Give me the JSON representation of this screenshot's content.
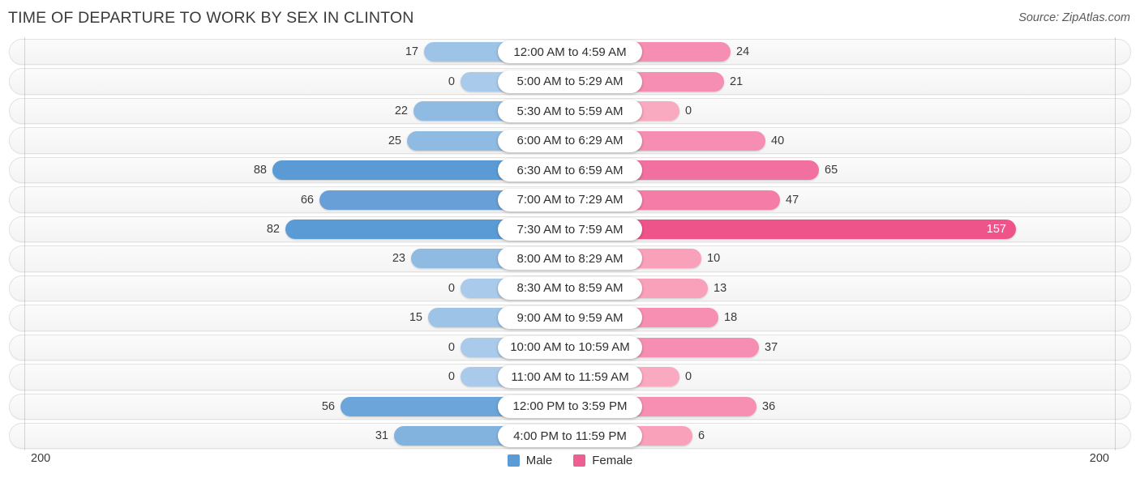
{
  "header": {
    "title": "TIME OF DEPARTURE TO WORK BY SEX IN CLINTON",
    "source": "Source: ZipAtlas.com"
  },
  "axis": {
    "left_label": "200",
    "right_label": "200"
  },
  "legend": {
    "items": [
      {
        "label": "Male",
        "color": "#5B9BD5",
        "icon": "square-swatch"
      },
      {
        "label": "Female",
        "color": "#ED5E93",
        "icon": "square-swatch"
      }
    ]
  },
  "colors": {
    "male_strong": "#5B9BD5",
    "male_light": "#9DC3E6",
    "female_strong": "#EE5389",
    "female_mid": "#F47CA6",
    "female_light": "#F9A9C0",
    "track": "#F6F6F6",
    "text": "#3A3A3A"
  },
  "chart_data": {
    "type": "bar",
    "orientation": "horizontal",
    "style": "diverging-bidirectional",
    "title": "TIME OF DEPARTURE TO WORK BY SEX IN CLINTON",
    "xlabel": "",
    "ylabel": "",
    "axis_max": 200,
    "xlim": [
      200,
      200
    ],
    "grid": false,
    "legend_position": "bottom-center",
    "categories": [
      "12:00 AM to 4:59 AM",
      "5:00 AM to 5:29 AM",
      "5:30 AM to 5:59 AM",
      "6:00 AM to 6:29 AM",
      "6:30 AM to 6:59 AM",
      "7:00 AM to 7:29 AM",
      "7:30 AM to 7:59 AM",
      "8:00 AM to 8:29 AM",
      "8:30 AM to 8:59 AM",
      "9:00 AM to 9:59 AM",
      "10:00 AM to 10:59 AM",
      "11:00 AM to 11:59 AM",
      "12:00 PM to 3:59 PM",
      "4:00 PM to 11:59 PM"
    ],
    "series": [
      {
        "name": "Male",
        "values": [
          17,
          0,
          22,
          25,
          88,
          66,
          82,
          23,
          0,
          15,
          0,
          0,
          56,
          31
        ]
      },
      {
        "name": "Female",
        "values": [
          24,
          21,
          0,
          40,
          65,
          47,
          157,
          10,
          13,
          18,
          37,
          0,
          36,
          6
        ]
      }
    ]
  },
  "rows": [
    {
      "label": "12:00 AM to 4:59 AM",
      "male": "17",
      "female": "24",
      "male_w": 107,
      "female_w": 125,
      "male_color": "#9DC3E6",
      "female_color": "#F58EB2",
      "female_inside": false
    },
    {
      "label": "5:00 AM to 5:29 AM",
      "male": "0",
      "female": "21",
      "male_w": 62,
      "female_w": 117,
      "male_color": "#A9CAEA",
      "female_color": "#F58EB2",
      "female_inside": false
    },
    {
      "label": "5:30 AM to 5:59 AM",
      "male": "22",
      "female": "0",
      "male_w": 120,
      "female_w": 62,
      "male_color": "#8FBAE2",
      "female_color": "#F9A9C0",
      "female_inside": false
    },
    {
      "label": "6:00 AM to 6:29 AM",
      "male": "25",
      "female": "40",
      "male_w": 128,
      "female_w": 168,
      "male_color": "#8FBAE2",
      "female_color": "#F58EB2",
      "female_inside": false
    },
    {
      "label": "6:30 AM to 6:59 AM",
      "male": "88",
      "female": "65",
      "male_w": 294,
      "female_w": 234,
      "male_color": "#5B9BD5",
      "female_color": "#F2709F",
      "female_inside": false
    },
    {
      "label": "7:00 AM to 7:29 AM",
      "male": "66",
      "female": "47",
      "male_w": 236,
      "female_w": 186,
      "male_color": "#689FD6",
      "female_color": "#F47CA6",
      "female_inside": false
    },
    {
      "label": "7:30 AM to 7:59 AM",
      "male": "82",
      "female": "157",
      "male_w": 278,
      "female_w": 477,
      "male_color": "#5B9BD5",
      "female_color": "#EE5389",
      "female_inside": true
    },
    {
      "label": "8:00 AM to 8:29 AM",
      "male": "23",
      "female": "10",
      "male_w": 123,
      "female_w": 89,
      "male_color": "#8FBAE2",
      "female_color": "#F9A0BA",
      "female_inside": false
    },
    {
      "label": "8:30 AM to 8:59 AM",
      "male": "0",
      "female": "13",
      "male_w": 62,
      "female_w": 97,
      "male_color": "#A9CAEA",
      "female_color": "#F9A0BA",
      "female_inside": false
    },
    {
      "label": "9:00 AM to 9:59 AM",
      "male": "15",
      "female": "18",
      "male_w": 102,
      "female_w": 110,
      "male_color": "#9DC3E6",
      "female_color": "#F78FB2",
      "female_inside": false
    },
    {
      "label": "10:00 AM to 10:59 AM",
      "male": "0",
      "female": "37",
      "male_w": 62,
      "female_w": 160,
      "male_color": "#A9CAEA",
      "female_color": "#F58EB2",
      "female_inside": false
    },
    {
      "label": "11:00 AM to 11:59 AM",
      "male": "0",
      "female": "0",
      "male_w": 62,
      "female_w": 62,
      "male_color": "#A9CAEA",
      "female_color": "#F9A9C0",
      "female_inside": false
    },
    {
      "label": "12:00 PM to 3:59 PM",
      "male": "56",
      "female": "36",
      "male_w": 210,
      "female_w": 157,
      "male_color": "#6CA5D9",
      "female_color": "#F78FB2",
      "female_inside": false
    },
    {
      "label": "4:00 PM to 11:59 PM",
      "male": "31",
      "female": "6",
      "male_w": 144,
      "female_w": 78,
      "male_color": "#82B3DF",
      "female_color": "#F9A0BA",
      "female_inside": false
    }
  ]
}
